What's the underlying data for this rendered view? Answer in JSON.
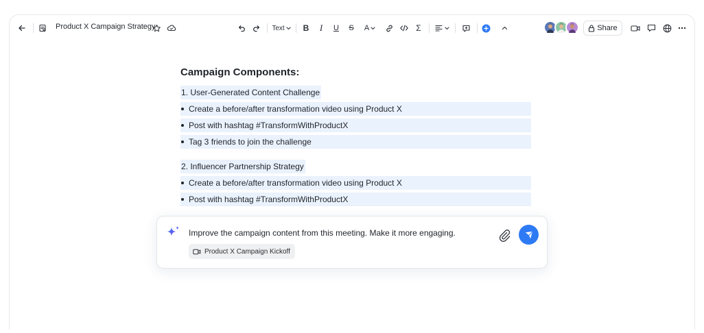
{
  "document": {
    "title": "Product X Campaign Strategy"
  },
  "toolbar": {
    "text_style_label": "Text",
    "bold_label": "B",
    "italic_label": "I",
    "underline_label": "U",
    "strike_label": "S",
    "font_color_label": "A",
    "formula_label": "Σ",
    "share_label": "Share"
  },
  "content": {
    "heading": "Campaign Components:",
    "sections": [
      {
        "title": "1. User-Generated Content Challenge",
        "bullets": [
          "Create a before/after transformation video using Product X",
          "Post with hashtag #TransformWithProductX",
          "Tag 3 friends to join the challenge"
        ]
      },
      {
        "title": "2. Influencer Partnership Strategy",
        "bullets": [
          "Create a before/after transformation video using Product X",
          "Post with hashtag #TransformWithProductX"
        ]
      }
    ]
  },
  "prompt": {
    "text": "Improve the campaign content from this meeting. Make it more engaging.",
    "attachment_label": "Product X Campaign Kickoff"
  },
  "colors": {
    "accent": "#2e7af5",
    "highlight": "#eaf2fd",
    "text": "#1f2329"
  },
  "icons": {
    "back": "arrow-left-icon",
    "doc": "document-icon",
    "star": "star-icon",
    "cloud": "cloud-icon",
    "undo": "undo-icon",
    "redo": "redo-icon",
    "link": "link-icon",
    "code": "code-icon",
    "align": "align-icon",
    "comment": "comment-icon",
    "add": "plus-circle-icon",
    "collapse": "chevron-up-icon",
    "lock": "lock-icon",
    "video": "video-icon",
    "chat": "chat-icon",
    "globe": "globe-icon",
    "more": "more-icon",
    "sparkle": "sparkle-icon",
    "attach": "paperclip-icon",
    "send": "send-icon"
  }
}
